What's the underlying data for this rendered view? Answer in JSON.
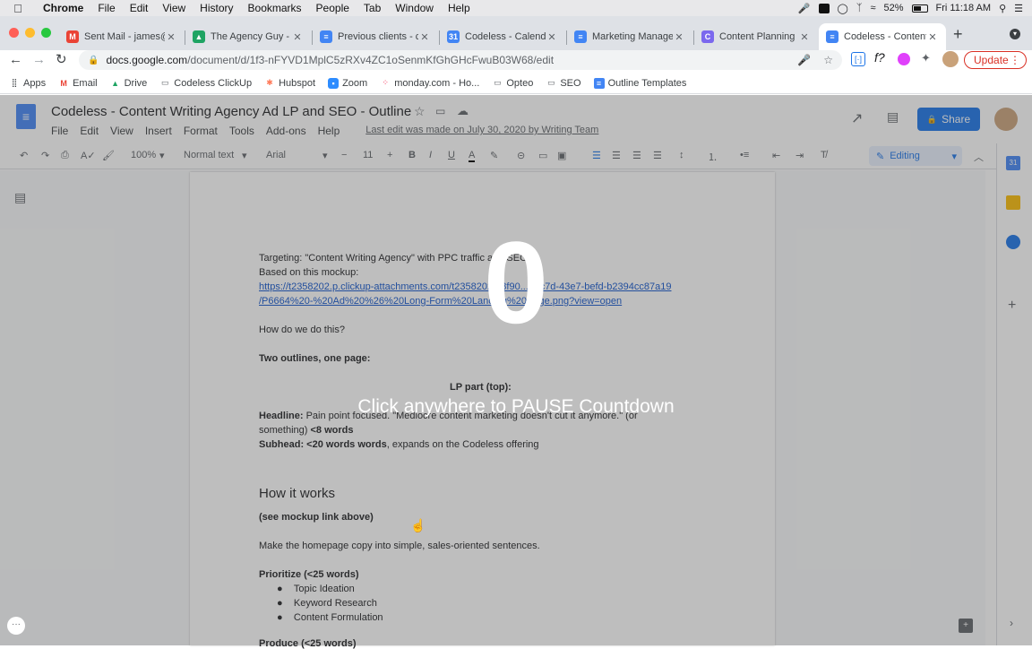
{
  "menubar": {
    "app": "Chrome",
    "items": [
      "File",
      "Edit",
      "View",
      "History",
      "Bookmarks",
      "People",
      "Tab",
      "Window",
      "Help"
    ],
    "battery": "52%",
    "clock": "Fri 11:18 AM"
  },
  "tabs": [
    {
      "title": "Sent Mail - james@",
      "favicon": "gmail-icon",
      "color": "#ea4335"
    },
    {
      "title": "The Agency Guy - C",
      "favicon": "drive-icon",
      "color": "#1fa463"
    },
    {
      "title": "Previous clients - co",
      "favicon": "docs-icon",
      "color": "#4285f4"
    },
    {
      "title": "Codeless - Calenda",
      "favicon": "calendar-icon",
      "color": "#4285f4"
    },
    {
      "title": "Marketing Managem",
      "favicon": "docs-icon",
      "color": "#4285f4"
    },
    {
      "title": "Content Planning | E",
      "favicon": "clickup-icon",
      "color": "#7b68ee"
    },
    {
      "title": "Codeless - Content",
      "favicon": "docs-icon",
      "color": "#4285f4"
    }
  ],
  "omnibox": {
    "host": "docs.google.com",
    "path": "/document/d/1f3-nFYVD1MplC5zRXv4ZC1oSenmKfGhGHcFwuB03W68/edit"
  },
  "update_label": "Update",
  "bookmarks": [
    {
      "label": "Apps",
      "icon": "apps-grid-icon"
    },
    {
      "label": "Email",
      "icon": "gmail-icon"
    },
    {
      "label": "Drive",
      "icon": "drive-icon"
    },
    {
      "label": "Codeless ClickUp",
      "icon": "folder-icon"
    },
    {
      "label": "Hubspot",
      "icon": "hubspot-icon"
    },
    {
      "label": "Zoom",
      "icon": "zoom-icon"
    },
    {
      "label": "monday.com - Ho...",
      "icon": "monday-icon"
    },
    {
      "label": "Opteo",
      "icon": "folder-icon"
    },
    {
      "label": "SEO",
      "icon": "folder-icon"
    },
    {
      "label": "Outline Templates",
      "icon": "docs-icon"
    }
  ],
  "doc": {
    "title": "Codeless - Content Writing Agency Ad LP and SEO  - Outline",
    "menus": [
      "File",
      "Edit",
      "View",
      "Insert",
      "Format",
      "Tools",
      "Add-ons",
      "Help"
    ],
    "last_edit": "Last edit was made on July 30, 2020 by Writing Team",
    "share_label": "Share",
    "zoom": "100%",
    "style": "Normal text",
    "font": "Arial",
    "font_size": "11",
    "mode": "Editing"
  },
  "content": {
    "targeting": "Targeting: \"Content Writing Agency\" with PPC traffic and SEO",
    "based_on": "Based on this mockup:",
    "link1": "https://t2358202.p.clickup-attachments.com/t2358202/18f90... -dc7d-43e7-befd-b2394cc87a19",
    "link2": "/P6664%20-%20Ad%20%26%20Long-Form%20Landing%20Page.png?view=open",
    "how_do": "How do we do this?",
    "two_outlines": "Two outlines, one page:",
    "lp_part": "LP part (top):",
    "headline_label": "Headline:",
    "headline_text": " Pain point focused. \"Mediocre content marketing doesn't cut it anymore.\" (or",
    "headline_cont": "something) ",
    "headline_limit": "<8 words",
    "subhead_label": "Subhead: <20 words words",
    "subhead_text": ", expands on the Codeless offering",
    "how_it_works": "How it works",
    "see_mockup": "(see mockup link above)",
    "make_copy": "Make the homepage copy into simple, sales-oriented sentences.",
    "prioritize": "Prioritize (<25 words)",
    "bullets": [
      "Topic Ideation",
      "Keyword Research",
      "Content Formulation"
    ],
    "produce": "Produce (<25 words)"
  },
  "overlay": {
    "countdown": "0",
    "message": "Click anywhere to PAUSE Countdown"
  }
}
